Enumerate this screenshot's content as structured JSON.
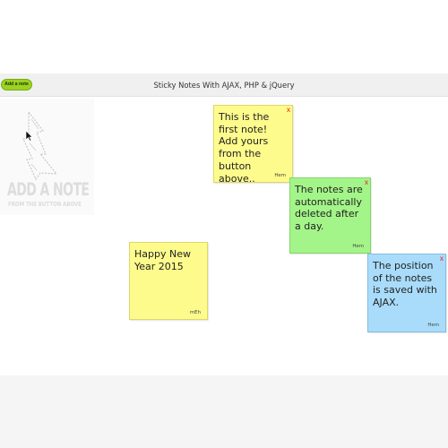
{
  "header": {
    "title": "Sticky Notes With AJAX, PHP & jQuery",
    "add_button_label": "Add a note"
  },
  "hint": {
    "line1": "ADD A NOTE",
    "line2": "FROM THE BUTTON ABOVE"
  },
  "notes": [
    {
      "text": "This is the first note! Add yours from the button above..",
      "author": "Hem",
      "delete_label": "x",
      "color": "yellow"
    },
    {
      "text": "The notes are automatically deleted after a day.",
      "author": "Hem",
      "delete_label": "x",
      "color": "green"
    },
    {
      "text": "The position of the notes is saved with AJAX.",
      "author": "Hem",
      "delete_label": "x",
      "color": "blue"
    },
    {
      "text": "Happy New Year 2015",
      "author": "mEh",
      "delete_label": "",
      "color": "yellow"
    }
  ],
  "colors": {
    "yellow": "#fdfb8c",
    "green": "#a4f589",
    "blue": "#a9dcfb",
    "button": "#9ad321",
    "delete": "#ea1e1e"
  }
}
